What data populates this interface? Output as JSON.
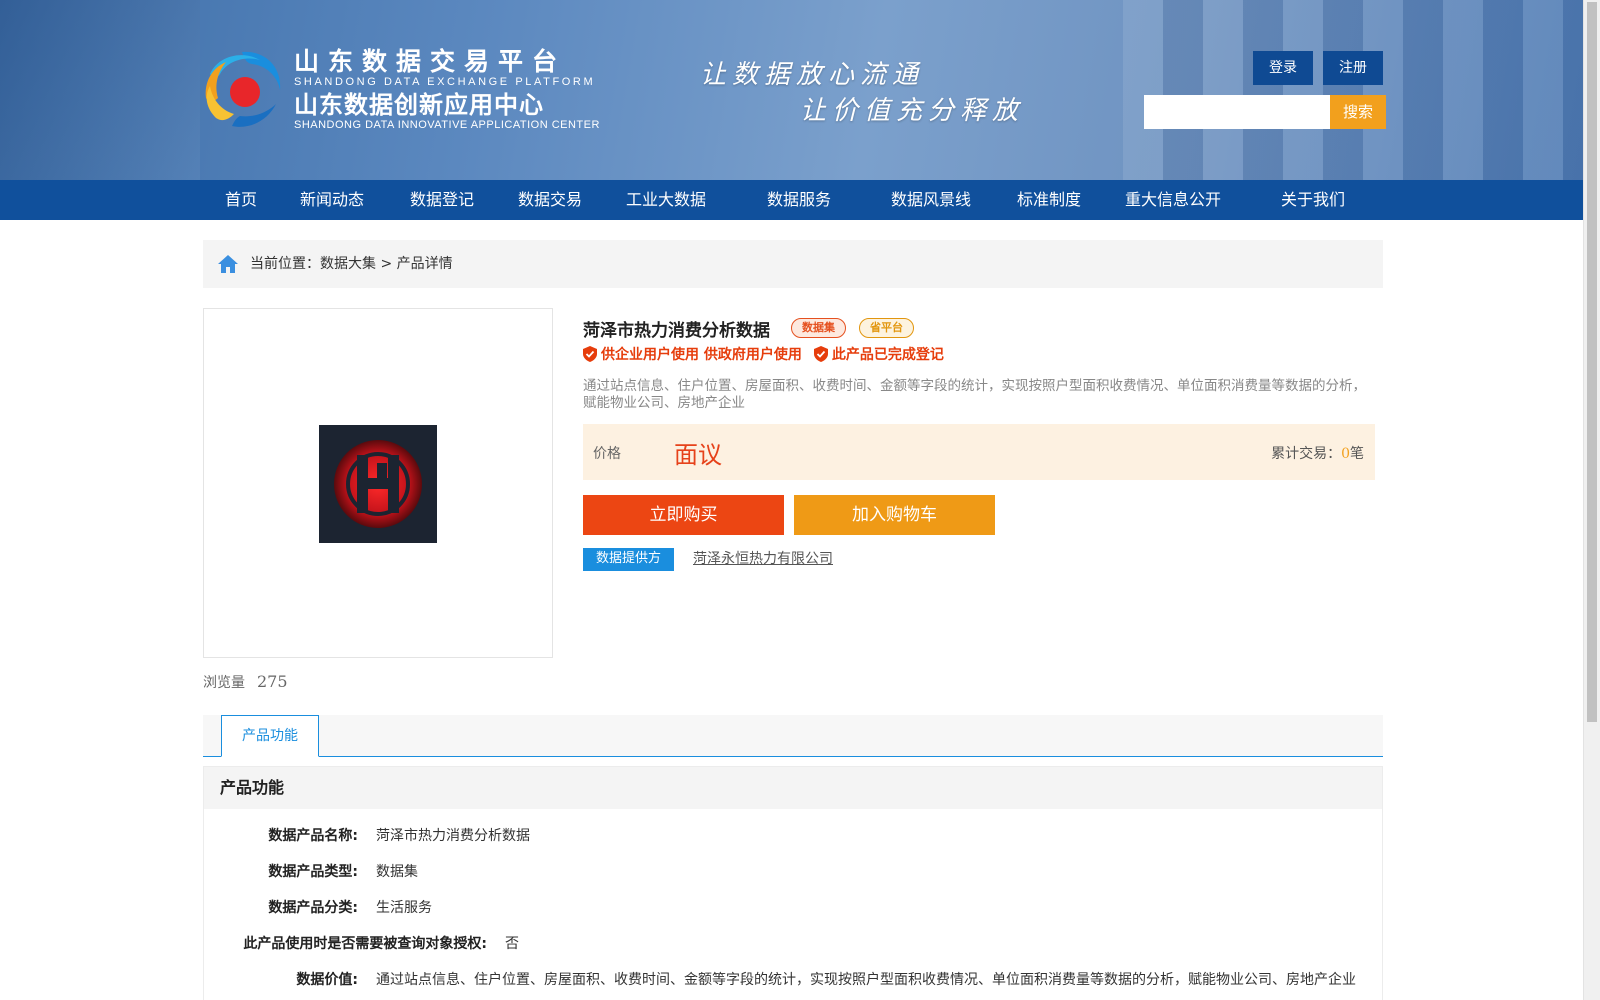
{
  "header": {
    "brand_cn": "山东数据交易平台",
    "brand_en": "SHANDONG DATA EXCHANGE PLATFORM",
    "center_cn": "山东数据创新应用中心",
    "center_en": "SHANDONG DATA INNOVATIVE APPLICATION CENTER",
    "slogan_1": "让数据放心流通",
    "slogan_2": "让价值充分释放",
    "login_label": "登录",
    "register_label": "注册",
    "search_placeholder": "",
    "search_label": "搜索"
  },
  "nav": {
    "items": [
      {
        "label": "首页"
      },
      {
        "label": "新闻动态"
      },
      {
        "label": "数据登记"
      },
      {
        "label": "数据交易"
      },
      {
        "label": "工业大数据"
      },
      {
        "label": "数据服务"
      },
      {
        "label": "数据风景线"
      },
      {
        "label": "标准制度"
      },
      {
        "label": "重大信息公开"
      },
      {
        "label": "关于我们"
      }
    ]
  },
  "breadcrumb": {
    "prefix": "当前位置：",
    "items": [
      "数据大集",
      "产品详情"
    ],
    "separator": " > "
  },
  "product": {
    "title": "菏泽市热力消费分析数据",
    "tag_dataset": "数据集",
    "tag_provincial": "省平台",
    "note_users": "供企业用户使用 供政府用户使用",
    "note_registered": "此产品已完成登记",
    "description": "通过站点信息、住户位置、房屋面积、收费时间、金额等字段的统计，实现按照户型面积收费情况、单位面积消费量等数据的分析，赋能物业公司、房地产企业",
    "price_label": "价格",
    "price_value": "面议",
    "trade_label": "累计交易：",
    "trade_count": "0",
    "trade_unit": "笔",
    "buy_label": "立即购买",
    "cart_label": "加入购物车",
    "provider_tag": "数据提供方",
    "provider_name": "菏泽永恒热力有限公司",
    "views_label": "浏览量",
    "views_count": "275"
  },
  "tabs": [
    {
      "label": "产品功能",
      "active": true
    }
  ],
  "details": {
    "heading": "产品功能",
    "rows": [
      {
        "key": "数据产品名称:",
        "value": "菏泽市热力消费分析数据"
      },
      {
        "key": "数据产品类型:",
        "value": "数据集"
      },
      {
        "key": "数据产品分类:",
        "value": "生活服务"
      },
      {
        "key": "此产品使用时是否需要被查询对象授权:",
        "value": "否"
      },
      {
        "key": "数据价值:",
        "value": "通过站点信息、住户位置、房屋面积、收费时间、金额等字段的统计，实现按照户型面积收费情况、单位面积消费量等数据的分析，赋能物业公司、房地产企业"
      }
    ]
  },
  "colors": {
    "nav_blue": "#10509c",
    "accent_orange": "#f2a01d",
    "buy_red": "#ec4613",
    "tab_blue": "#1a8ede"
  },
  "icons": [
    "logo-icon",
    "home-icon",
    "shield-check-icon"
  ]
}
